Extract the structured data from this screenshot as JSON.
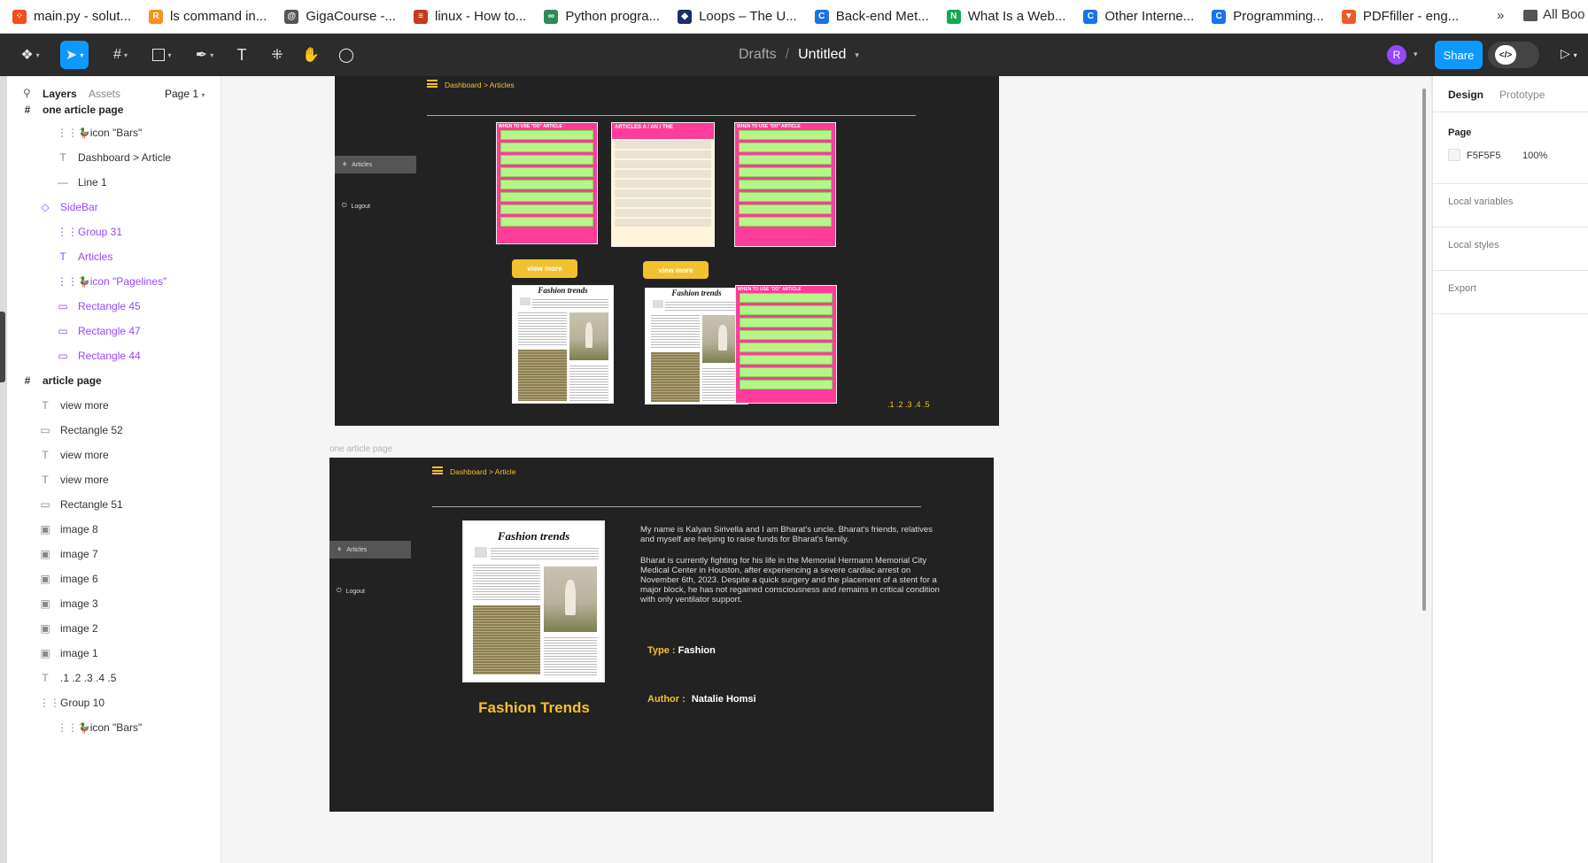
{
  "bookmarks": [
    {
      "label": "main.py - solut...",
      "icon": "figma-dots-icon",
      "color": "#f24e1e"
    },
    {
      "label": "ls command in...",
      "icon": "r-icon",
      "color": "#f7931e"
    },
    {
      "label": "GigaCourse -...",
      "icon": "spiral-icon",
      "color": "#555555"
    },
    {
      "label": "linux - How to...",
      "icon": "stack-icon",
      "color": "#c33b1e"
    },
    {
      "label": "Python progra...",
      "icon": "link-icon",
      "color": "#2e8b57"
    },
    {
      "label": "Loops – The U...",
      "icon": "diamond-icon",
      "color": "#1c2e6b"
    },
    {
      "label": "Back-end Met...",
      "icon": "c-icon",
      "color": "#1a73e8"
    },
    {
      "label": "What Is a Web...",
      "icon": "n-icon",
      "color": "#13aa52"
    },
    {
      "label": "Other Interne...",
      "icon": "c-icon",
      "color": "#1a73e8"
    },
    {
      "label": "Programming...",
      "icon": "c-icon",
      "color": "#1a73e8"
    },
    {
      "label": "PDFfiller - eng...",
      "icon": "pdffiller-icon",
      "color": "#f05a28"
    }
  ],
  "bookmarks_more": "»",
  "bookmarks_all": "All Boo",
  "toolbar": {
    "breadcrumb_drafts": "Drafts",
    "breadcrumb_sep": "/",
    "file_name": "Untitled",
    "avatar_letter": "R",
    "share_label": "Share",
    "accent": "#0d99ff"
  },
  "left_panel": {
    "tab_layers": "Layers",
    "tab_assets": "Assets",
    "page_selector": "Page 1",
    "layers": [
      {
        "name": "one article page",
        "icon": "frame-icon",
        "kind": "frame"
      },
      {
        "name": "icon \"Bars\"",
        "icon": "component-icon",
        "kind": "child2"
      },
      {
        "name": "Dashboard > Article",
        "icon": "text-icon",
        "kind": "child2"
      },
      {
        "name": "Line 1",
        "icon": "line-icon",
        "kind": "child2"
      },
      {
        "name": "SideBar",
        "icon": "diamond-icon",
        "kind": "purple1"
      },
      {
        "name": "Group 31",
        "icon": "group-icon",
        "kind": "purple2"
      },
      {
        "name": "Articles",
        "icon": "text-icon",
        "kind": "purple2"
      },
      {
        "name": "icon \"Pagelines\"",
        "icon": "component-icon",
        "kind": "purple2"
      },
      {
        "name": "Rectangle 45",
        "icon": "rectangle-icon",
        "kind": "purple2"
      },
      {
        "name": "Rectangle 47",
        "icon": "rectangle-icon",
        "kind": "purple2"
      },
      {
        "name": "Rectangle 44",
        "icon": "rectangle-icon",
        "kind": "purple2"
      },
      {
        "name": "article page",
        "icon": "frame-icon",
        "kind": "frame"
      },
      {
        "name": "view more",
        "icon": "text-icon",
        "kind": "child1"
      },
      {
        "name": "Rectangle 52",
        "icon": "rectangle-icon",
        "kind": "child1"
      },
      {
        "name": "view more",
        "icon": "text-icon",
        "kind": "child1"
      },
      {
        "name": "view more",
        "icon": "text-icon",
        "kind": "child1"
      },
      {
        "name": "Rectangle 51",
        "icon": "rectangle-icon",
        "kind": "child1"
      },
      {
        "name": "image 8",
        "icon": "image-icon",
        "kind": "child1"
      },
      {
        "name": "image 7",
        "icon": "image-icon",
        "kind": "child1"
      },
      {
        "name": "image 6",
        "icon": "image-icon",
        "kind": "child1"
      },
      {
        "name": "image 3",
        "icon": "image-icon",
        "kind": "child1"
      },
      {
        "name": "image 2",
        "icon": "image-icon",
        "kind": "child1"
      },
      {
        "name": "image 1",
        "icon": "image-icon",
        "kind": "child1"
      },
      {
        "name": ".1 .2 .3 .4 .5",
        "icon": "text-icon",
        "kind": "child1"
      },
      {
        "name": "Group 10",
        "icon": "group-icon",
        "kind": "child1"
      },
      {
        "name": "icon \"Bars\"",
        "icon": "component-icon",
        "kind": "child2"
      }
    ]
  },
  "right_panel": {
    "tab_design": "Design",
    "tab_prototype": "Prototype",
    "page_heading": "Page",
    "page_color": "F5F5F5",
    "page_opacity": "100%",
    "local_variables": "Local variables",
    "local_styles": "Local styles",
    "export": "Export"
  },
  "article_page": {
    "breadcrumb": "Dashboard > Articles",
    "sidebar_item": "Articles",
    "logout": "Logout",
    "view_more": "view more",
    "card_title_when": "WHEN TO USE \"DO\" ARTICLE",
    "card_title_articles": "ARTICLES A / AN / THE",
    "fashion_title": "Fashion trends",
    "pagination": ".1 .2 .3 .4 .5"
  },
  "one_article_page": {
    "frame_label": "one article page",
    "breadcrumb": "Dashboard > Article",
    "sidebar_item": "Articles",
    "logout": "Logout",
    "image_title": "Fashion trends",
    "headline": "Fashion Trends",
    "paragraph1": "My name is Kalyan Sirivella and I am Bharat's uncle. Bharat's friends, relatives and myself are helping to raise funds for Bharat's family.",
    "paragraph2": "Bharat is currently fighting for his life in the Memorial Hermann Memorial City Medical Center in Houston, after experiencing a severe cardiac arrest on November 6th, 2023. Despite a quick surgery and the placement of a stent for a major block, he has not regained consciousness and remains in critical condition with only ventilator support.",
    "type_label": "Type :",
    "type_value": "Fashion",
    "author_label": "Author :",
    "author_value": "Natalie Homsi",
    "accent": "#f2c12e"
  }
}
